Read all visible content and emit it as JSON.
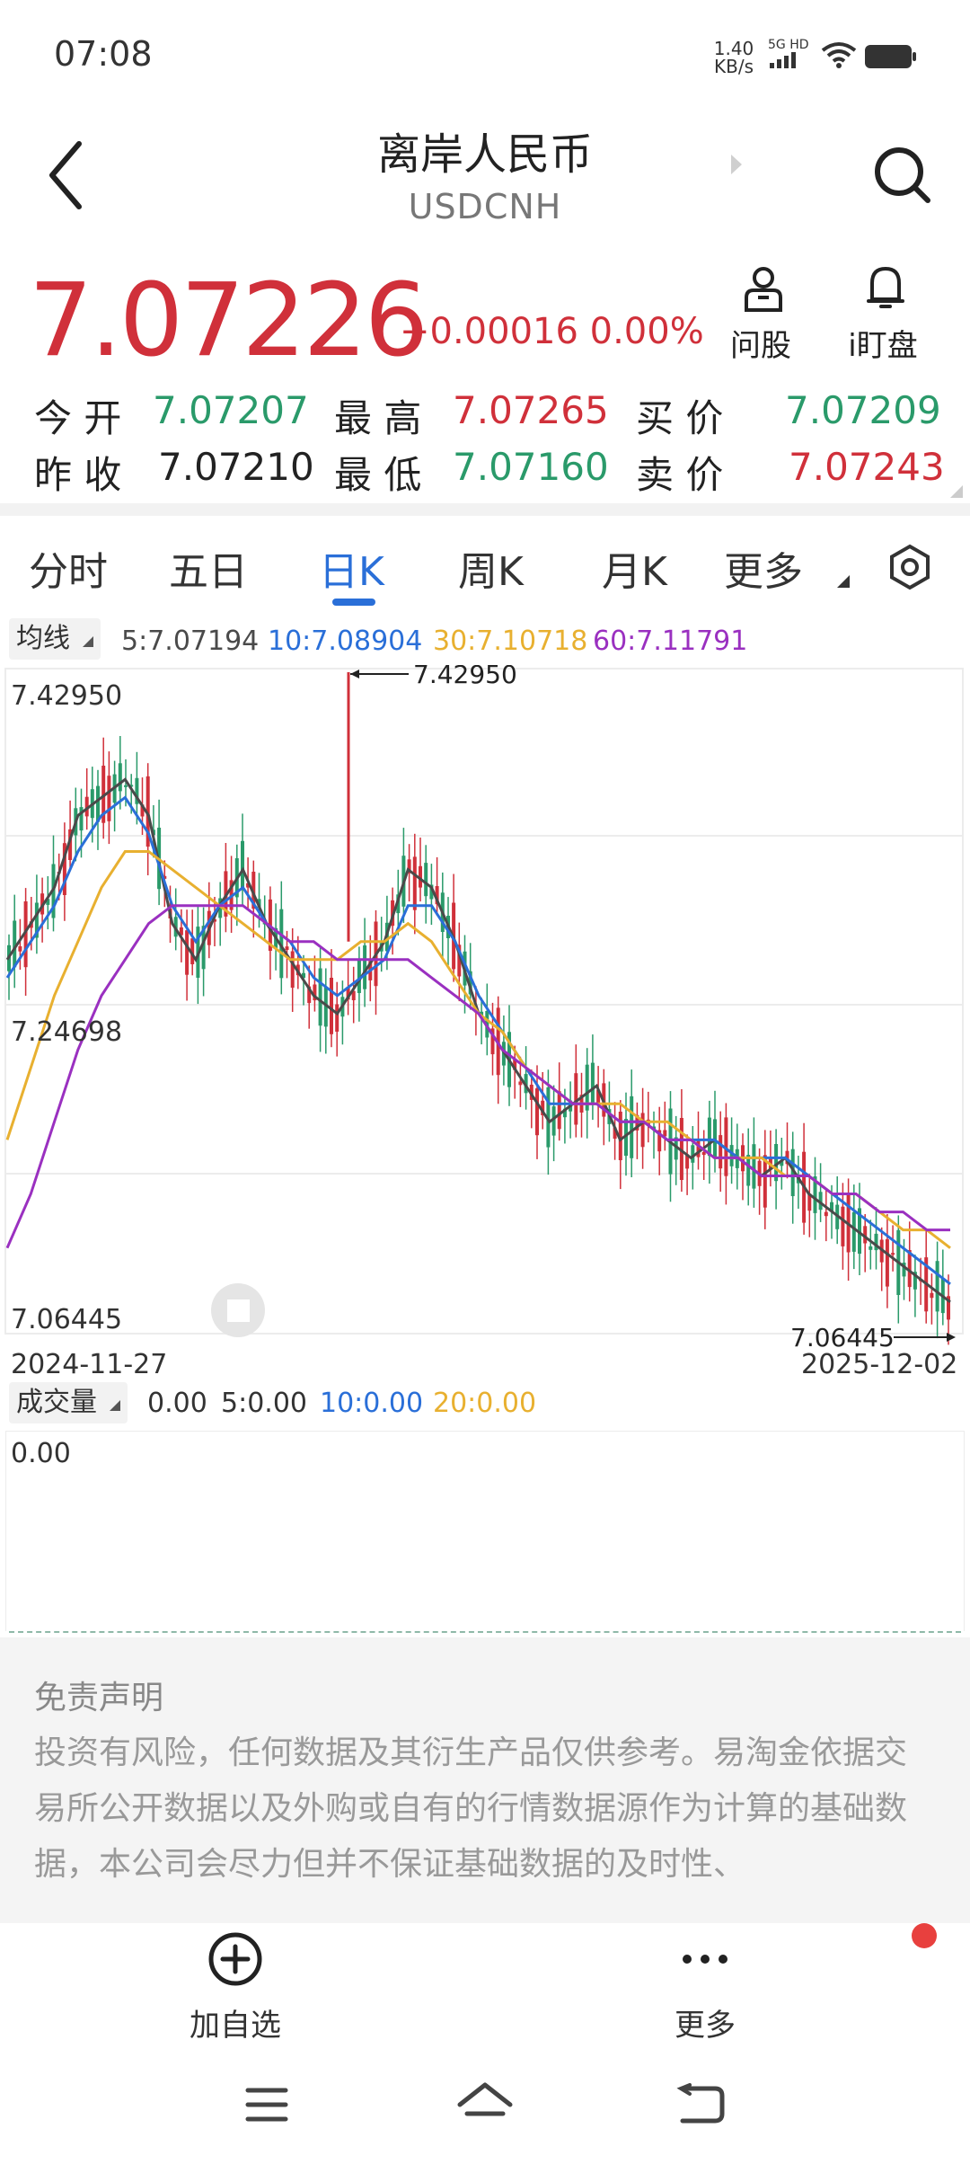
{
  "status": {
    "time": "07:08",
    "speed_value": "1.40",
    "speed_unit": "KB/s",
    "network": "5G HD"
  },
  "header": {
    "title": "离岸人民币",
    "subtitle": "USDCNH"
  },
  "quote": {
    "price": "7.07226",
    "change": "+0.00016 0.00%",
    "btn_ask": "问股",
    "btn_watch": "i盯盘"
  },
  "stats": {
    "open_label": "今 开",
    "open": "7.07207",
    "high_label": "最 高",
    "high": "7.07265",
    "bid_label": "买 价",
    "bid": "7.07209",
    "prev_label": "昨 收",
    "prev": "7.07210",
    "low_label": "最 低",
    "low": "7.07160",
    "ask_label": "卖 价",
    "ask": "7.07243"
  },
  "tabs": [
    "分时",
    "五日",
    "日K",
    "周K",
    "月K",
    "更多"
  ],
  "active_tab": "日K",
  "ma": {
    "label": "均线",
    "ma5": "5:7.07194",
    "ma10": "10:7.08904",
    "ma30": "30:7.10718",
    "ma60": "60:7.11791"
  },
  "colors": {
    "up": "#d0303a",
    "down": "#2a9a6a",
    "ma5": "#4a4a4a",
    "ma10": "#2a6fd8",
    "ma30": "#e8b030",
    "ma60": "#9a30c0",
    "accent": "#2a6fd8"
  },
  "chart_data": {
    "type": "candlestick",
    "x_start": "2024-11-27",
    "x_end": "2025-12-02",
    "y_labels": [
      "7.42950",
      "7.24698",
      "7.06445"
    ],
    "max_marker": "7.42950",
    "min_marker": "7.06445",
    "ylim": [
      7.06445,
      7.4295
    ],
    "series": [
      {
        "name": "5",
        "values": [
          7.27,
          7.29,
          7.31,
          7.35,
          7.36,
          7.37,
          7.35,
          7.29,
          7.27,
          7.3,
          7.32,
          7.29,
          7.27,
          7.25,
          7.24,
          7.26,
          7.28,
          7.32,
          7.31,
          7.28,
          7.24,
          7.22,
          7.2,
          7.18,
          7.19,
          7.2,
          7.17,
          7.18,
          7.17,
          7.16,
          7.17,
          7.16,
          7.15,
          7.16,
          7.14,
          7.13,
          7.12,
          7.11,
          7.1,
          7.09,
          7.08
        ]
      },
      {
        "name": "10",
        "values": [
          7.26,
          7.28,
          7.3,
          7.33,
          7.35,
          7.36,
          7.34,
          7.3,
          7.28,
          7.3,
          7.31,
          7.29,
          7.28,
          7.26,
          7.25,
          7.26,
          7.27,
          7.3,
          7.3,
          7.28,
          7.25,
          7.23,
          7.21,
          7.19,
          7.19,
          7.19,
          7.18,
          7.18,
          7.17,
          7.17,
          7.17,
          7.16,
          7.16,
          7.16,
          7.15,
          7.14,
          7.13,
          7.12,
          7.11,
          7.1,
          7.09
        ]
      },
      {
        "name": "30",
        "values": [
          7.17,
          7.21,
          7.25,
          7.28,
          7.31,
          7.33,
          7.33,
          7.32,
          7.31,
          7.3,
          7.29,
          7.28,
          7.27,
          7.27,
          7.27,
          7.28,
          7.28,
          7.29,
          7.28,
          7.26,
          7.24,
          7.23,
          7.21,
          7.2,
          7.19,
          7.19,
          7.19,
          7.18,
          7.18,
          7.17,
          7.16,
          7.16,
          7.16,
          7.15,
          7.15,
          7.14,
          7.14,
          7.13,
          7.12,
          7.12,
          7.11
        ]
      },
      {
        "name": "60",
        "values": [
          7.11,
          7.14,
          7.18,
          7.22,
          7.25,
          7.27,
          7.29,
          7.3,
          7.3,
          7.3,
          7.3,
          7.29,
          7.28,
          7.28,
          7.27,
          7.27,
          7.27,
          7.27,
          7.26,
          7.25,
          7.24,
          7.22,
          7.21,
          7.2,
          7.19,
          7.19,
          7.18,
          7.18,
          7.17,
          7.17,
          7.16,
          7.16,
          7.15,
          7.15,
          7.15,
          7.14,
          7.14,
          7.13,
          7.13,
          7.12,
          7.12
        ]
      }
    ]
  },
  "volume": {
    "label": "成交量",
    "value": "0.00",
    "ma5": "5:0.00",
    "ma10": "10:0.00",
    "ma20": "20:0.00",
    "axis_zero": "0.00"
  },
  "disclaimer": {
    "title": "免责声明",
    "body": "投资有风险，任何数据及其衍生产品仅供参考。易淘金依据交易所公开数据以及外购或自有的行情数据源作为计算的基础数据，本公司会尽力但并不保证基础数据的及时性、"
  },
  "bottom": {
    "add_label": "加自选",
    "more_label": "更多"
  }
}
